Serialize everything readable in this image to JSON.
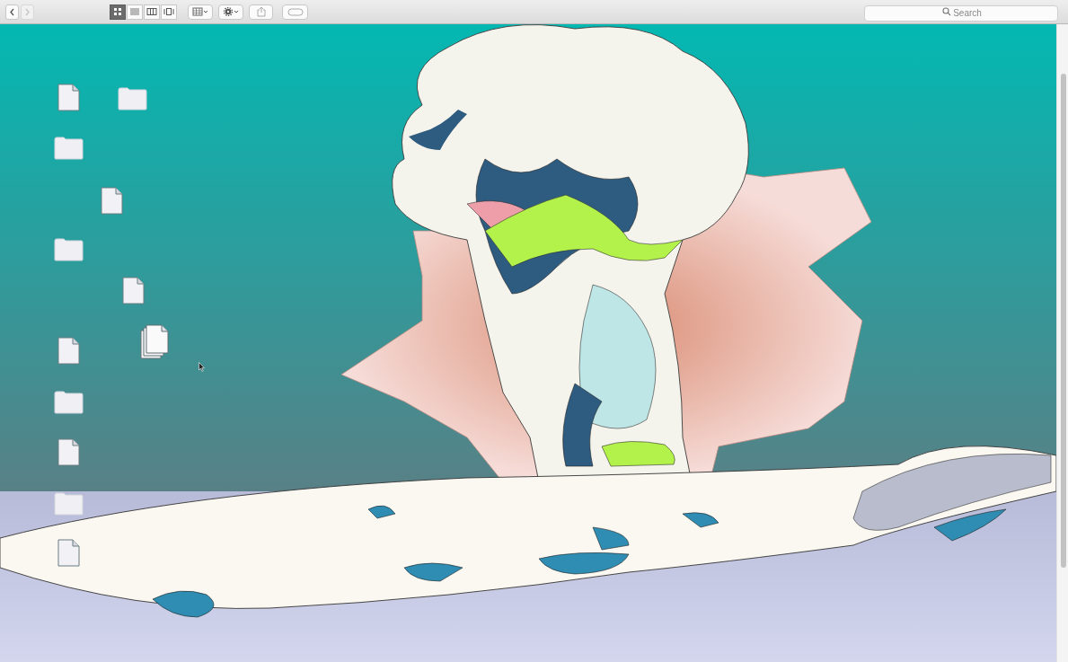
{
  "toolbar": {
    "nav": [
      {
        "kind": "back",
        "disabled": false
      },
      {
        "kind": "forward",
        "disabled": true
      }
    ],
    "views": [
      {
        "kind": "icon",
        "selected": true
      },
      {
        "kind": "list",
        "selected": false
      },
      {
        "kind": "column",
        "selected": false
      },
      {
        "kind": "coverflow",
        "selected": false
      }
    ],
    "search": {
      "placeholder": "Search"
    }
  },
  "desktop_items": [
    {
      "kind": "file"
    },
    {
      "kind": "folder"
    },
    {
      "kind": "folder"
    },
    {
      "kind": "file"
    },
    {
      "kind": "folder"
    },
    {
      "kind": "file"
    },
    {
      "kind": "stack"
    },
    {
      "kind": "file"
    },
    {
      "kind": "folder"
    },
    {
      "kind": "file"
    },
    {
      "kind": "folder"
    },
    {
      "kind": "file"
    }
  ]
}
